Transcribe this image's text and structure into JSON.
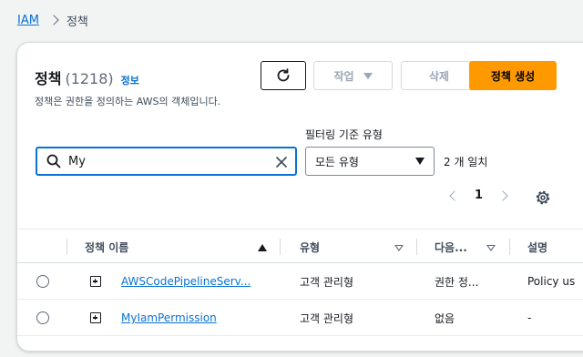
{
  "breadcrumb": {
    "root": "IAM",
    "current": "정책"
  },
  "header": {
    "title": "정책",
    "count": "(1218)",
    "info": "정보",
    "description": "정책은 권한을 정의하는 AWS의 객체입니다."
  },
  "toolbar": {
    "refresh_icon": "refresh-icon",
    "actions_label": "작업",
    "delete_label": "삭제",
    "create_label": "정책 생성"
  },
  "filter": {
    "search_value": "My",
    "type_label": "필터링 기준 유형",
    "type_selected": "모든 유형",
    "match_count": "2 개 일치"
  },
  "pagination": {
    "current_page": "1"
  },
  "table": {
    "columns": [
      "정책 이름",
      "유형",
      "다음...",
      "설명"
    ],
    "rows": [
      {
        "name": "AWSCodePipelineServ...",
        "type": "고객 관리형",
        "next": "권한 정...",
        "description": "Policy us"
      },
      {
        "name": "MyIamPermission",
        "type": "고객 관리형",
        "next": "없음",
        "description": "-"
      }
    ]
  },
  "colors": {
    "link": "#0972d3",
    "primary": "#ff9900",
    "text": "#16191f"
  }
}
